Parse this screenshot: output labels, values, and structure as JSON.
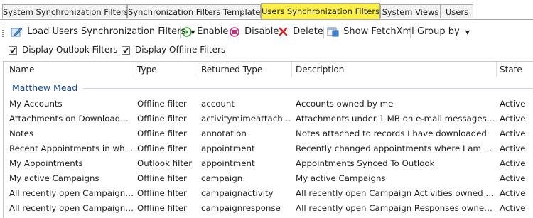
{
  "tabs": [
    {
      "label": "System Synchronization Filters",
      "active": false
    },
    {
      "label": "Synchronization Filters Templates",
      "active": false
    },
    {
      "label": "Users Synchronization Filters",
      "active": true
    },
    {
      "label": "System Views",
      "active": false
    },
    {
      "label": "Users",
      "active": false
    }
  ],
  "toolbar": {
    "load_label": "Load Users Synchronization Filters",
    "enable_label": "Enable",
    "disable_label": "Disable",
    "delete_label": "Delete",
    "fetchxml_label": "Show FetchXml",
    "groupby_label": "Group by",
    "icons": [
      "load-icon",
      "dropdown-arrow-icon",
      "enable-icon",
      "disable-icon",
      "delete-icon",
      "fetchxml-icon",
      "dropdown-arrow-icon"
    ]
  },
  "options": {
    "outlook": {
      "label": "Display Outlook Filters",
      "checked": true
    },
    "offline": {
      "label": "Display Offline Filters",
      "checked": true
    }
  },
  "columns": [
    "Name",
    "Type",
    "Returned Type",
    "Description",
    "State"
  ],
  "group": {
    "label": "Matthew Mead"
  },
  "rows": [
    {
      "name": "My Accounts",
      "type": "Offline filter",
      "returned": "account",
      "description": "Accounts owned by me",
      "state": "Active"
    },
    {
      "name": "Attachments on Downloaded ...",
      "type": "Offline filter",
      "returned": "activitymimeattachm...",
      "description": "Attachments under 1 MB on e-mail messages I h...",
      "state": "Active"
    },
    {
      "name": "Notes",
      "type": "Offline filter",
      "returned": "annotation",
      "description": "Notes attached to records I have downloaded",
      "state": "Active"
    },
    {
      "name": "Recent Appointments in whic...",
      "type": "Offline filter",
      "returned": "appointment",
      "description": "Recently changed appointments where I am a pa...",
      "state": "Active"
    },
    {
      "name": "My Appointments",
      "type": "Outlook filter",
      "returned": "appointment",
      "description": "Appointments Synced To Outlook",
      "state": "Active"
    },
    {
      "name": "My active Campaigns",
      "type": "Offline filter",
      "returned": "campaign",
      "description": "My active Campaigns",
      "state": "Active"
    },
    {
      "name": "All recently open Campaign A...",
      "type": "Offline filter",
      "returned": "campaignactivity",
      "description": "All recently open Campaign Activities owned by ...",
      "state": "Active"
    },
    {
      "name": "All recently open Campaign R...",
      "type": "Offline filter",
      "returned": "campaignresponse",
      "description": "All recently open Campaign Responses owned by...",
      "state": "Active"
    }
  ],
  "colors": {
    "accent_tab": "#fdf04a",
    "group_text": "#1a4a9a",
    "enable_green": "#2a9d2a",
    "disable_magenta": "#d4237a",
    "delete_red": "#d42020"
  }
}
